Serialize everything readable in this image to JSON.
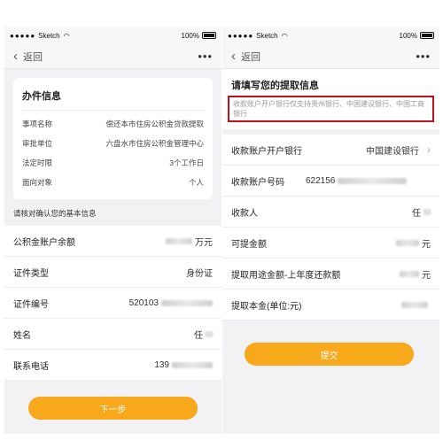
{
  "left": {
    "status": {
      "dots": "●●●●●",
      "carrier": "Sketch",
      "wifi_icon": "wifi-icon",
      "battery": "100%"
    },
    "nav": {
      "back_label": "返回",
      "more": "•••"
    },
    "info_card": {
      "title": "办件信息",
      "rows": [
        {
          "label": "事项名称",
          "value": "偿还本市住房公积金贷款提取"
        },
        {
          "label": "审批单位",
          "value": "六盘水市住房公积金管理中心"
        },
        {
          "label": "法定时限",
          "value": "3个工作日"
        },
        {
          "label": "面向对象",
          "value": "个人"
        }
      ]
    },
    "hint": "请核对确认您的基本信息",
    "fields": [
      {
        "label": "公积金账户余额",
        "value": "万元"
      },
      {
        "label": "证件类型",
        "value": "身份证"
      },
      {
        "label": "证件编号",
        "value": "520103"
      },
      {
        "label": "姓名",
        "value": "任"
      },
      {
        "label": "联系电话",
        "value": "139"
      }
    ],
    "next_button": "下一步"
  },
  "right": {
    "status": {
      "dots": "●●●●●",
      "carrier": "Sketch",
      "wifi_icon": "wifi-icon",
      "battery": "100%"
    },
    "nav": {
      "back_label": "返回",
      "more": "•••"
    },
    "title": "请填写您的提取信息",
    "notice": "收款账户开户银行仅支持贵州银行、中国建设银行、中国工商银行",
    "fields": [
      {
        "label": "收款账户开户银行",
        "value": "中国建设银行"
      },
      {
        "label": "收款账户号码",
        "value": "622156"
      },
      {
        "label": "收款人",
        "value": "任"
      },
      {
        "label": "可提金额",
        "value": "元"
      },
      {
        "label": "提取用途金额-上年度还款额",
        "value": "元"
      },
      {
        "label": "提取本金(单位:元)",
        "value": ""
      }
    ],
    "submit_button": "提交"
  },
  "colors": {
    "accent": "#f7a81b",
    "highlight_border": "#c0121a"
  }
}
